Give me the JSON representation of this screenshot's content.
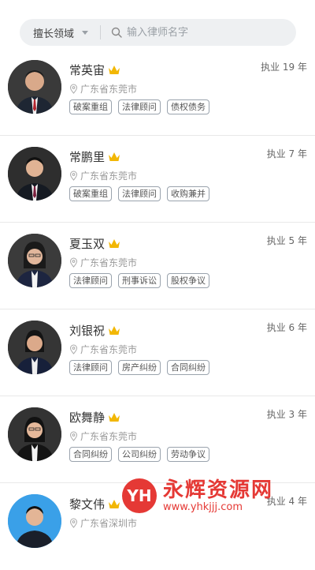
{
  "search": {
    "domain_label": "擅长领域",
    "placeholder": "输入律师名字"
  },
  "lawyers": [
    {
      "name": "常英宙",
      "years": "执业 19 年",
      "location": "广东省东莞市",
      "tags": [
        "破案重组",
        "法律顾问",
        "债权债务"
      ]
    },
    {
      "name": "常鹏里",
      "years": "执业 7 年",
      "location": "广东省东莞市",
      "tags": [
        "破案重组",
        "法律顾问",
        "收购兼并"
      ]
    },
    {
      "name": "夏玉双",
      "years": "执业 5 年",
      "location": "广东省东莞市",
      "tags": [
        "法律顾问",
        "刑事诉讼",
        "股权争议"
      ]
    },
    {
      "name": "刘银祝",
      "years": "执业 6 年",
      "location": "广东省东莞市",
      "tags": [
        "法律顾问",
        "房产纠纷",
        "合同纠纷"
      ]
    },
    {
      "name": "欧舞静",
      "years": "执业 3 年",
      "location": "广东省东莞市",
      "tags": [
        "合同纠纷",
        "公司纠纷",
        "劳动争议"
      ]
    },
    {
      "name": "黎文伟",
      "years": "执业 4 年",
      "location": "广东省深圳市",
      "tags": []
    }
  ],
  "watermark": {
    "logo": "YH",
    "title": "永辉资源网",
    "url": "www.yhkjjj.com"
  },
  "colors": {
    "crown": "#f2b705",
    "tag_border": "#9aa3ad",
    "watermark": "#e53935"
  }
}
